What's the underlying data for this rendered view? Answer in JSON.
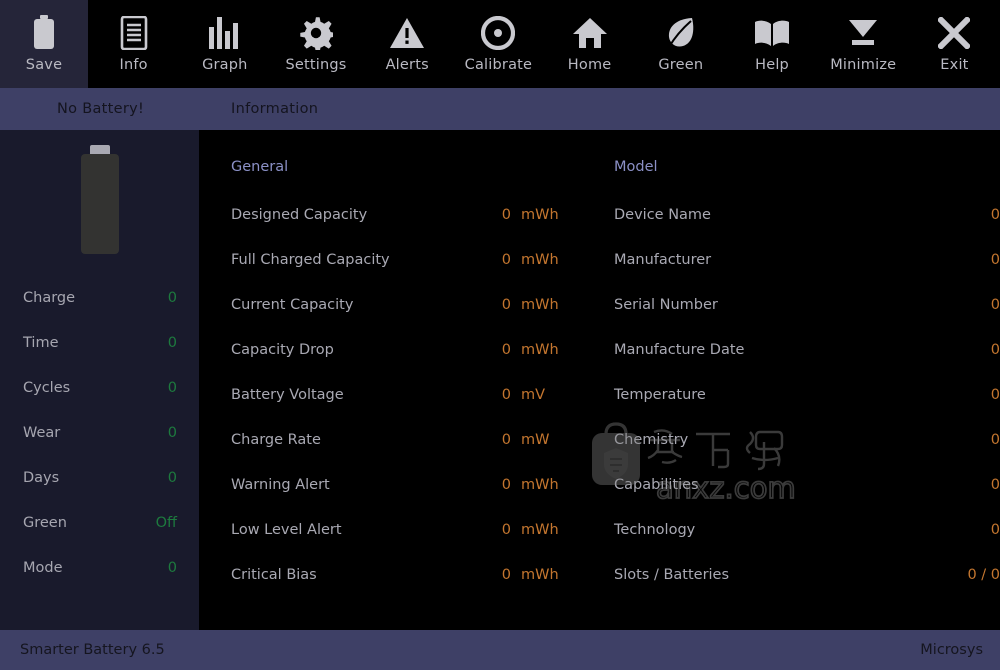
{
  "app": {
    "title": "Smarter Battery 6.5",
    "vendor": "Microsys"
  },
  "colors": {
    "toolbar_bg": "#000000",
    "toolbar_active_bg": "#252539",
    "subheader_bg": "#3e4066",
    "sidebar_bg": "#191a2c",
    "content_bg": "#000000",
    "section_title": "#8b90c6",
    "label": "#a9a9b3",
    "value_amber": "#c4762f",
    "value_green": "#1d7a3e",
    "footer_bg": "#3e4066",
    "footer_text": "#15151f",
    "battery_body": "#333331",
    "battery_cap": "#a9a9b2"
  },
  "toolbar": {
    "items": [
      {
        "label": "Save",
        "icon": "battery-icon",
        "active": true
      },
      {
        "label": "Info",
        "icon": "document-icon",
        "active": false
      },
      {
        "label": "Graph",
        "icon": "bar-chart-icon",
        "active": false
      },
      {
        "label": "Settings",
        "icon": "gear-icon",
        "active": false
      },
      {
        "label": "Alerts",
        "icon": "warning-icon",
        "active": false
      },
      {
        "label": "Calibrate",
        "icon": "target-icon",
        "active": false
      },
      {
        "label": "Home",
        "icon": "home-icon",
        "active": false
      },
      {
        "label": "Green",
        "icon": "leaf-icon",
        "active": false
      },
      {
        "label": "Help",
        "icon": "book-icon",
        "active": false
      },
      {
        "label": "Minimize",
        "icon": "minimize-icon",
        "active": false
      },
      {
        "label": "Exit",
        "icon": "close-icon",
        "active": false
      }
    ]
  },
  "subheader": {
    "battery_status": "No Battery!",
    "page": "Information"
  },
  "sidebar": {
    "battery_icon": "battery-vertical-icon",
    "stats": [
      {
        "label": "Charge",
        "value": "0"
      },
      {
        "label": "Time",
        "value": "0"
      },
      {
        "label": "Cycles",
        "value": "0"
      },
      {
        "label": "Wear",
        "value": "0"
      },
      {
        "label": "Days",
        "value": "0"
      },
      {
        "label": "Green",
        "value": "Off"
      },
      {
        "label": "Mode",
        "value": "0"
      }
    ]
  },
  "main": {
    "general": {
      "title": "General",
      "rows": [
        {
          "label": "Designed Capacity",
          "value": "0",
          "unit": "mWh"
        },
        {
          "label": "Full Charged Capacity",
          "value": "0",
          "unit": "mWh"
        },
        {
          "label": "Current Capacity",
          "value": "0",
          "unit": "mWh"
        },
        {
          "label": "Capacity Drop",
          "value": "0",
          "unit": "mWh"
        },
        {
          "label": "Battery Voltage",
          "value": "0",
          "unit": "mV"
        },
        {
          "label": "Charge Rate",
          "value": "0",
          "unit": "mW"
        },
        {
          "label": "Warning Alert",
          "value": "0",
          "unit": "mWh"
        },
        {
          "label": "Low Level Alert",
          "value": "0",
          "unit": "mWh"
        },
        {
          "label": "Critical Bias",
          "value": "0",
          "unit": "mWh"
        }
      ]
    },
    "model": {
      "title": "Model",
      "rows": [
        {
          "label": "Device Name",
          "value": "0"
        },
        {
          "label": "Manufacturer",
          "value": "0"
        },
        {
          "label": "Serial Number",
          "value": "0"
        },
        {
          "label": "Manufacture Date",
          "value": "0"
        },
        {
          "label": "Temperature",
          "value": "0"
        },
        {
          "label": "Chemistry",
          "value": "0"
        },
        {
          "label": "Capabilities",
          "value": "0"
        },
        {
          "label": "Technology",
          "value": "0"
        },
        {
          "label": "Slots / Batteries",
          "value": "0 / 0"
        }
      ]
    }
  },
  "watermark": {
    "site": "anxz.com",
    "characters": "安下载",
    "icon": "bag-shield-icon"
  }
}
